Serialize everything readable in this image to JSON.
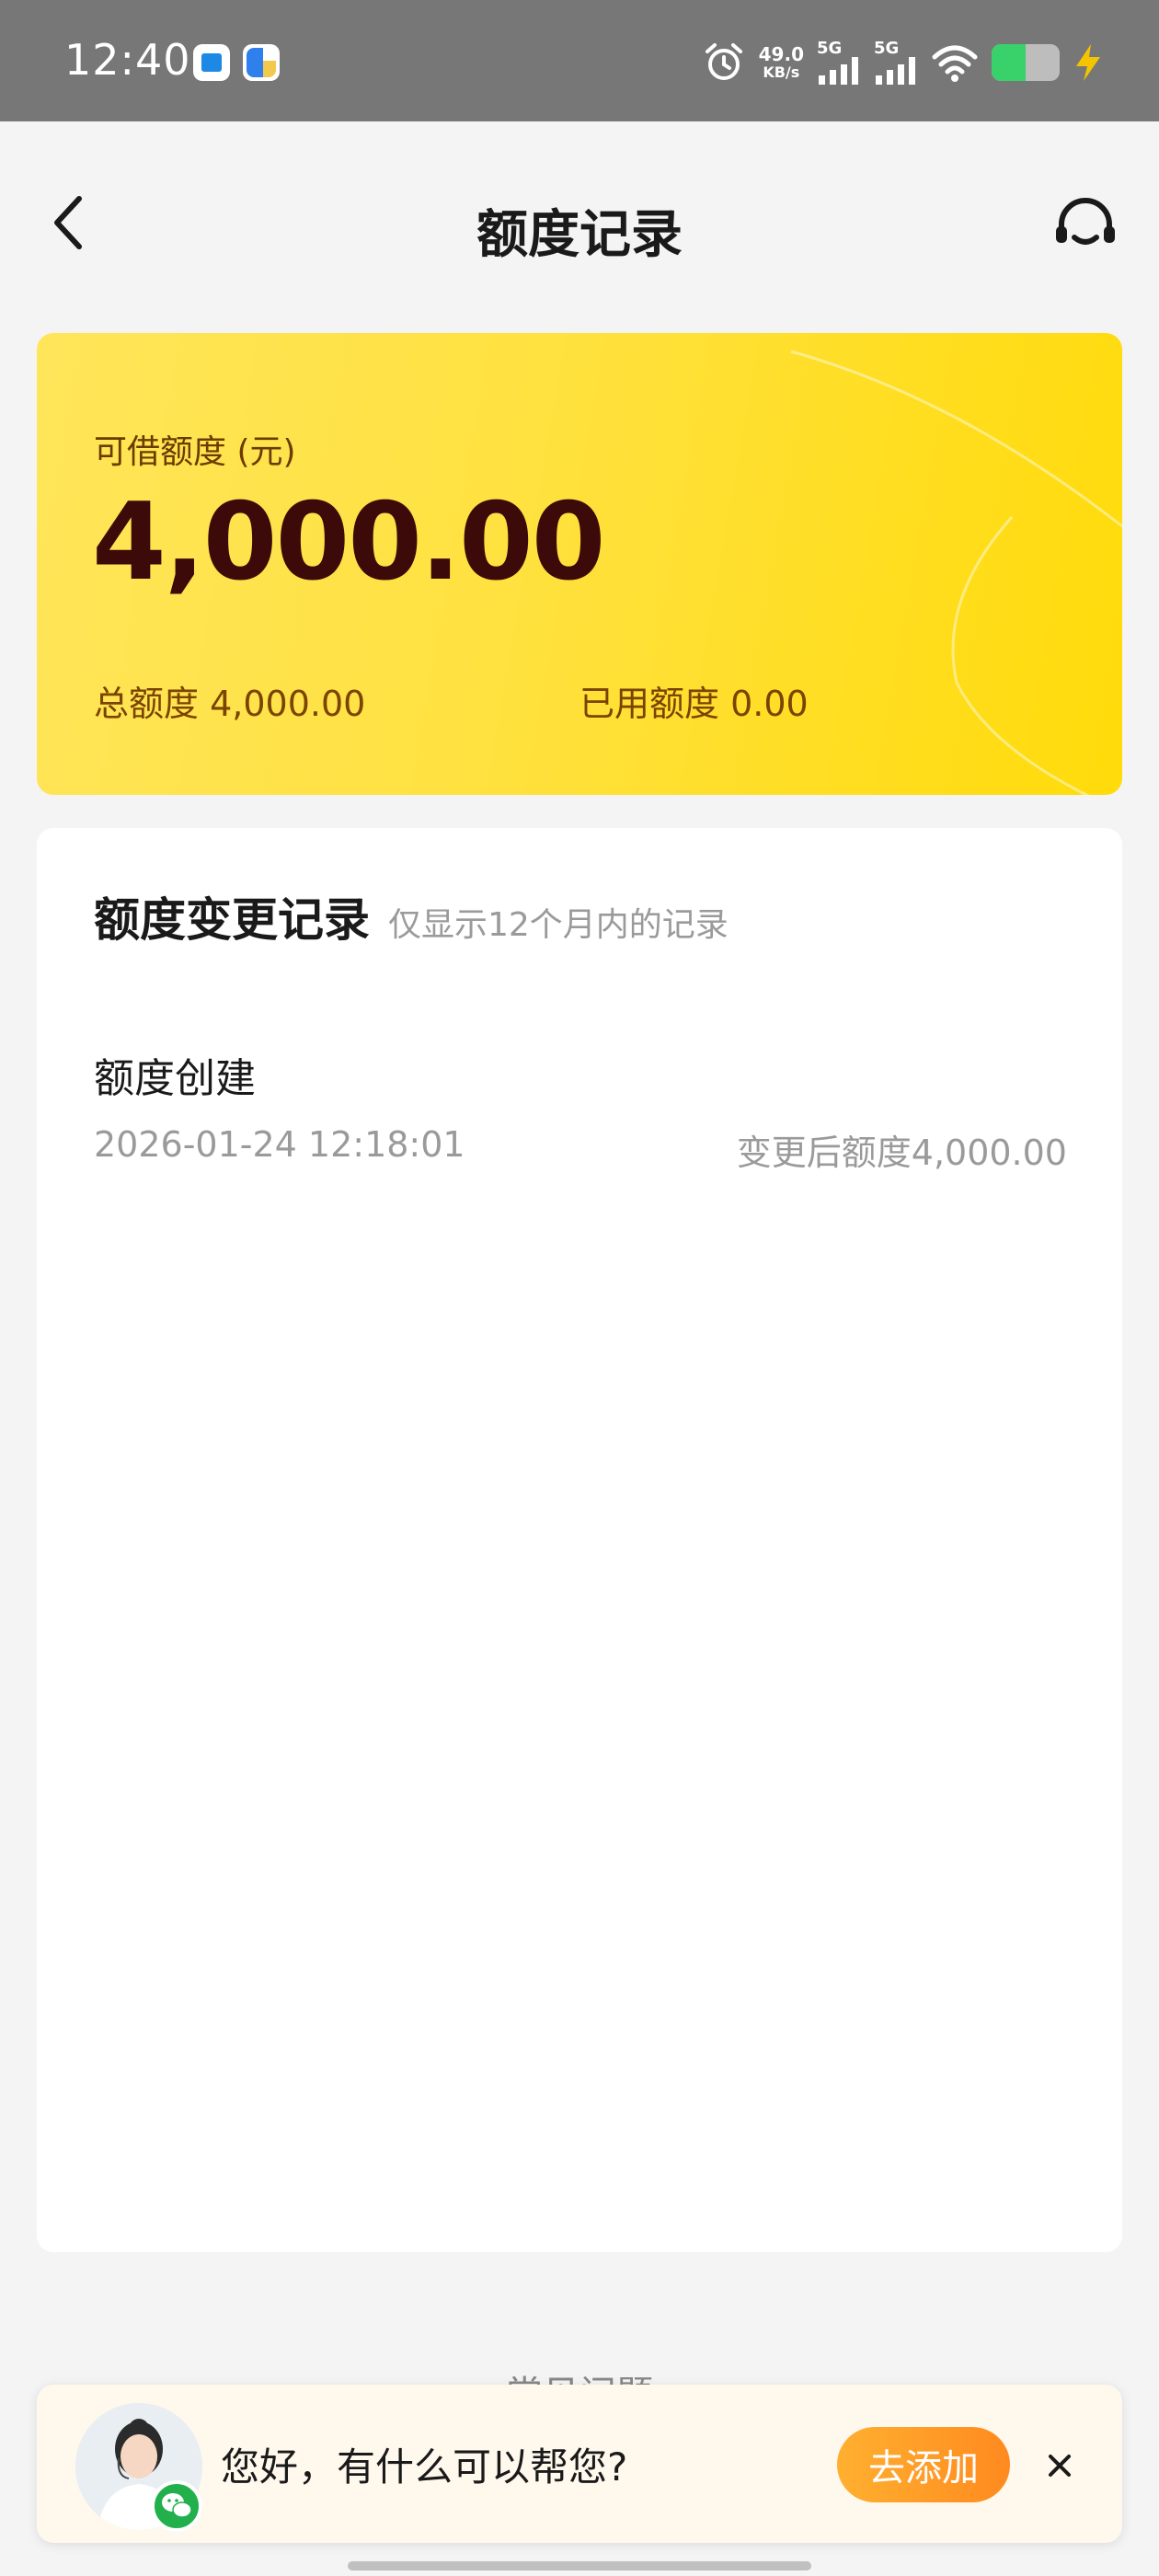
{
  "status_bar": {
    "time": "12:40",
    "net_speed_value": "49.0",
    "net_speed_unit": "KB/s",
    "signal1_label": "5G",
    "signal2_label": "5G",
    "battery_level": 0.5
  },
  "header": {
    "title": "额度记录"
  },
  "credit_card": {
    "label": "可借额度 (元)",
    "amount": "4,000.00",
    "total_text": "总额度 4,000.00",
    "used_text": "已用额度 0.00"
  },
  "records": {
    "title": "额度变更记录",
    "subtitle": "仅显示12个月内的记录",
    "items": [
      {
        "type": "额度创建",
        "datetime": "2026-01-24 12:18:01",
        "after_text": "变更后额度4,000.00"
      }
    ]
  },
  "faq_hint": "常见问题",
  "chat_banner": {
    "text": "您好，有什么可以帮您?",
    "button_label": "去添加"
  },
  "colors": {
    "card_yellow": "#ffe13f",
    "amount_text": "#3d0a0a",
    "button_orange": "#ff9a26",
    "wechat_green": "#21b04b"
  }
}
